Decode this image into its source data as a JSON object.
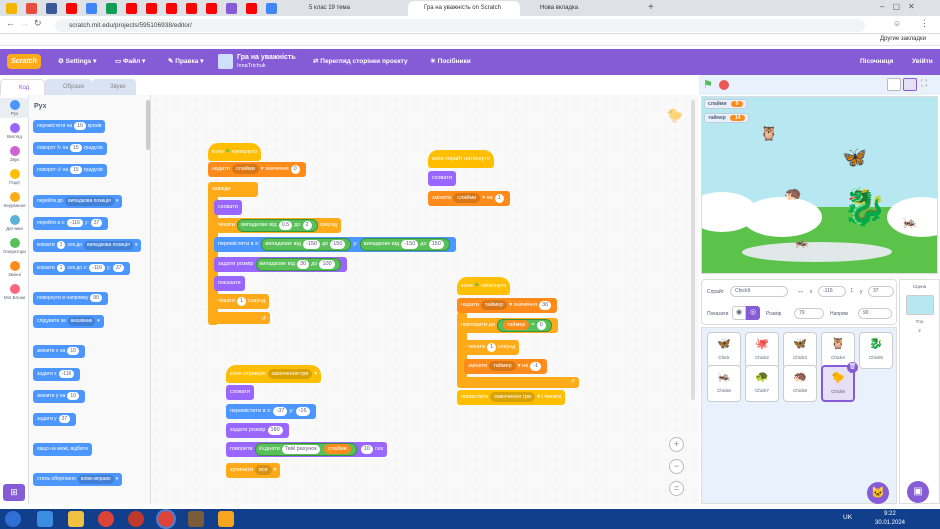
{
  "browser": {
    "tabs": [
      {
        "label": "5 клас 19 тема"
      },
      {
        "label": "Гра на уважність on Scratch"
      },
      {
        "label": "Нова вкладка"
      }
    ],
    "url": "scratch.mit.edu/projects/595106938/editor/",
    "bookmarks_other": "Другие закладки"
  },
  "menu": {
    "logo": "Scratch",
    "settings": "Settings",
    "file": "Файл",
    "edit": "Правка",
    "project_title": "Гра на уважність",
    "author": "InnaTrichuk",
    "see_project": "Перегляд сторінки проєкту",
    "tutorials": "Посібники",
    "remix": "Пісочниця",
    "sign_out": "Увійти"
  },
  "editor_tabs": {
    "code": "Код",
    "costumes": "Образи",
    "sounds": "Звуки"
  },
  "categories": [
    {
      "label": "Рух",
      "color": "#4c97ff"
    },
    {
      "label": "Вигляд",
      "color": "#9966ff"
    },
    {
      "label": "Звук",
      "color": "#cf63cf"
    },
    {
      "label": "Події",
      "color": "#ffbf00"
    },
    {
      "label": "Керування",
      "color": "#ffab19"
    },
    {
      "label": "Датчики",
      "color": "#5cb1d6"
    },
    {
      "label": "Оператори",
      "color": "#59c059"
    },
    {
      "label": "Змінні",
      "color": "#ff8c1a"
    },
    {
      "label": "Мої Блоки",
      "color": "#ff6680"
    }
  ],
  "palette": {
    "heading": "Рух",
    "b1": {
      "pre": "перемістити на",
      "num": "10",
      "post": "кроків"
    },
    "b2": {
      "pre": "поворот",
      "num": "15",
      "post": "градусів"
    },
    "b3": {
      "pre": "поворот",
      "num": "15",
      "post": "градусів"
    },
    "b4": {
      "pre": "перейти до",
      "drop": "випадкова позиція"
    },
    "b5": {
      "pre": "перейти в x:",
      "x": "-116",
      "mid": "y:",
      "y": "37"
    },
    "b6": {
      "pre": "ковзати",
      "n": "1",
      "mid": "сек до",
      "drop": "випадкова позиція"
    },
    "b7": {
      "pre": "ковзати",
      "n": "1",
      "mid": "сек до x:",
      "x": "-116",
      "mid2": "y:",
      "y": "37"
    },
    "b8": {
      "pre": "повернути в напрямку",
      "num": "90"
    },
    "b9": {
      "pre": "слідувати за",
      "drop": "вказівник"
    },
    "b10": {
      "pre": "змінити x на",
      "num": "10"
    },
    "b11": {
      "pre": "задати x",
      "num": "-116"
    },
    "b12": {
      "pre": "змінити y на",
      "num": "10"
    },
    "b13": {
      "pre": "задати y",
      "num": "37"
    },
    "b14": {
      "pre": "якщо на межі, відбити"
    },
    "b15": {
      "pre": "стиль обертання",
      "drop": "вліво-вправо"
    }
  },
  "scripts": {
    "s1": {
      "hat": "коли",
      "hat2": "натиснуто",
      "set_var": "надати",
      "set_drop": "слайми",
      "set_mid": "значення",
      "set_val": "0",
      "forever": "завжди",
      "hide": "сховати",
      "wait": "чекати",
      "rand": "випадкове від",
      "r_from": "0.5",
      "r_to": "до",
      "r_max": "2",
      "wait_post": "секунд",
      "goto": "перемістити в x:",
      "gx_from": "-150",
      "gx_max": "150",
      "gy": "y:",
      "gy_from": "-150",
      "gy_max": "150",
      "size": "задати розмір",
      "sz_from": "30",
      "sz_max": "100",
      "show": "показати",
      "wait2": "чекати",
      "wait2_num": "1",
      "wait2_post": "секунд"
    },
    "s2": {
      "hat": "коли отримую",
      "hat_drop": "закінчення гри",
      "hide": "сховати",
      "goto": "перемістити в x:",
      "x": "-37",
      "y_lbl": "y:",
      "y": "-16",
      "size": "задати розмір",
      "size_val": "180",
      "say": "говорити",
      "join": "з'єднати",
      "join_text": "Твій рахунок",
      "join_var": "слайми",
      "say_num": "10",
      "say_post": "сек",
      "stop": "зупинити",
      "stop_drop": "все"
    },
    "s3": {
      "hat": "коли спрайт натиснуто",
      "hide": "сховати",
      "change": "змінити",
      "change_drop": "слайми",
      "change_on": "на",
      "change_val": "1"
    },
    "s4": {
      "hat": "коли",
      "hat2": "натиснуто",
      "set": "надати",
      "set_drop": "таймер",
      "set_mid": "значення",
      "set_val": "30",
      "repeat_until": "повторити до",
      "cond_var": "таймер",
      "cond_op": "=",
      "cond_val": "0",
      "wait": "чекати",
      "wait_num": "1",
      "wait_post": "секунд",
      "change": "змінити",
      "change_drop": "таймер",
      "change_on": "на",
      "change_val": "-1",
      "broadcast": "оповістити",
      "bc_drop": "закінчення гри",
      "bc_post": "і чекати"
    }
  },
  "stage": {
    "monitor1_label": "слайми",
    "monitor1_value": "0",
    "monitor2_label": "таймер",
    "monitor2_value": "14"
  },
  "sprite_info": {
    "sprite_label": "Спрайт",
    "sprite_name": "Chick9",
    "x_label": "x",
    "x_val": "-116",
    "y_label": "y",
    "y_val": "37",
    "show_label": "Показати",
    "size_label": "Розмір",
    "size_val": "79",
    "dir_label": "Напрям",
    "dir_val": "90"
  },
  "sprites": [
    {
      "name": "Chick",
      "icon": "🦋"
    },
    {
      "name": "Chick2",
      "icon": "🐙"
    },
    {
      "name": "Chick3",
      "icon": "🦋"
    },
    {
      "name": "Chick4",
      "icon": "🦉"
    },
    {
      "name": "Chick5",
      "icon": "🐉"
    },
    {
      "name": "Chick6",
      "icon": "🦗"
    },
    {
      "name": "Chick7",
      "icon": "🐢"
    },
    {
      "name": "Chick8",
      "icon": "🦔"
    },
    {
      "name": "Chick9",
      "icon": "🐤"
    }
  ],
  "scene": {
    "label": "Сцена",
    "backdrops_label": "Тло",
    "backdrops_count": "2"
  },
  "taskbar": {
    "lang": "UK",
    "time": "9:22",
    "date": "30.01.2024"
  }
}
